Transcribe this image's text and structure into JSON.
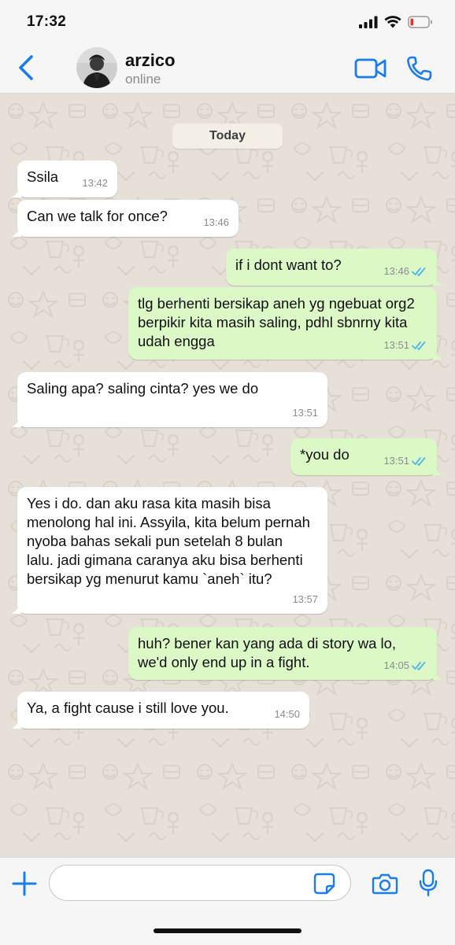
{
  "status_bar": {
    "time": "17:32"
  },
  "header": {
    "contact_name": "arzico",
    "contact_status": "online"
  },
  "chat": {
    "date_label": "Today",
    "messages": [
      {
        "direction": "in",
        "text": "Ssila",
        "time": "13:42"
      },
      {
        "direction": "in",
        "text": "Can we talk for once?",
        "time": "13:46"
      },
      {
        "direction": "out",
        "text": "if i dont want to?",
        "time": "13:46",
        "read": true
      },
      {
        "direction": "out",
        "text": "tlg berhenti bersikap aneh yg ngebuat org2 berpikir kita masih saling, pdhl sbnrny kita udah engga",
        "time": "13:51",
        "read": true
      },
      {
        "direction": "in",
        "text": "Saling apa? saling cinta? yes we do",
        "time": "13:51"
      },
      {
        "direction": "out",
        "text": "*you do",
        "time": "13:51",
        "read": true
      },
      {
        "direction": "in",
        "text": "Yes i do. dan aku rasa kita masih bisa menolong hal ini. Assyila, kita belum pernah nyoba bahas sekali pun setelah 8 bulan lalu. jadi gimana caranya aku bisa berhenti bersikap yg menurut kamu `aneh` itu?",
        "time": "13:57"
      },
      {
        "direction": "out",
        "text": "huh? bener kan yang ada di story wa lo, we'd only end up in a fight.",
        "time": "14:05",
        "read": true
      },
      {
        "direction": "in",
        "text": "Ya, a fight cause i still love you.",
        "time": "14:50"
      }
    ]
  },
  "composer": {
    "placeholder": ""
  },
  "colors": {
    "accent": "#1a7cf0",
    "incoming_bubble": "#ffffff",
    "outgoing_bubble": "#dcf8c6",
    "read_ticks": "#4fb6ec",
    "chat_background": "#e7e0d8"
  },
  "icons": {
    "back": "chevron-left-icon",
    "video": "video-camera-icon",
    "call": "phone-icon",
    "add": "plus-icon",
    "sticker": "sticker-icon",
    "camera": "camera-icon",
    "mic": "microphone-icon",
    "read_receipt": "double-check-icon"
  }
}
